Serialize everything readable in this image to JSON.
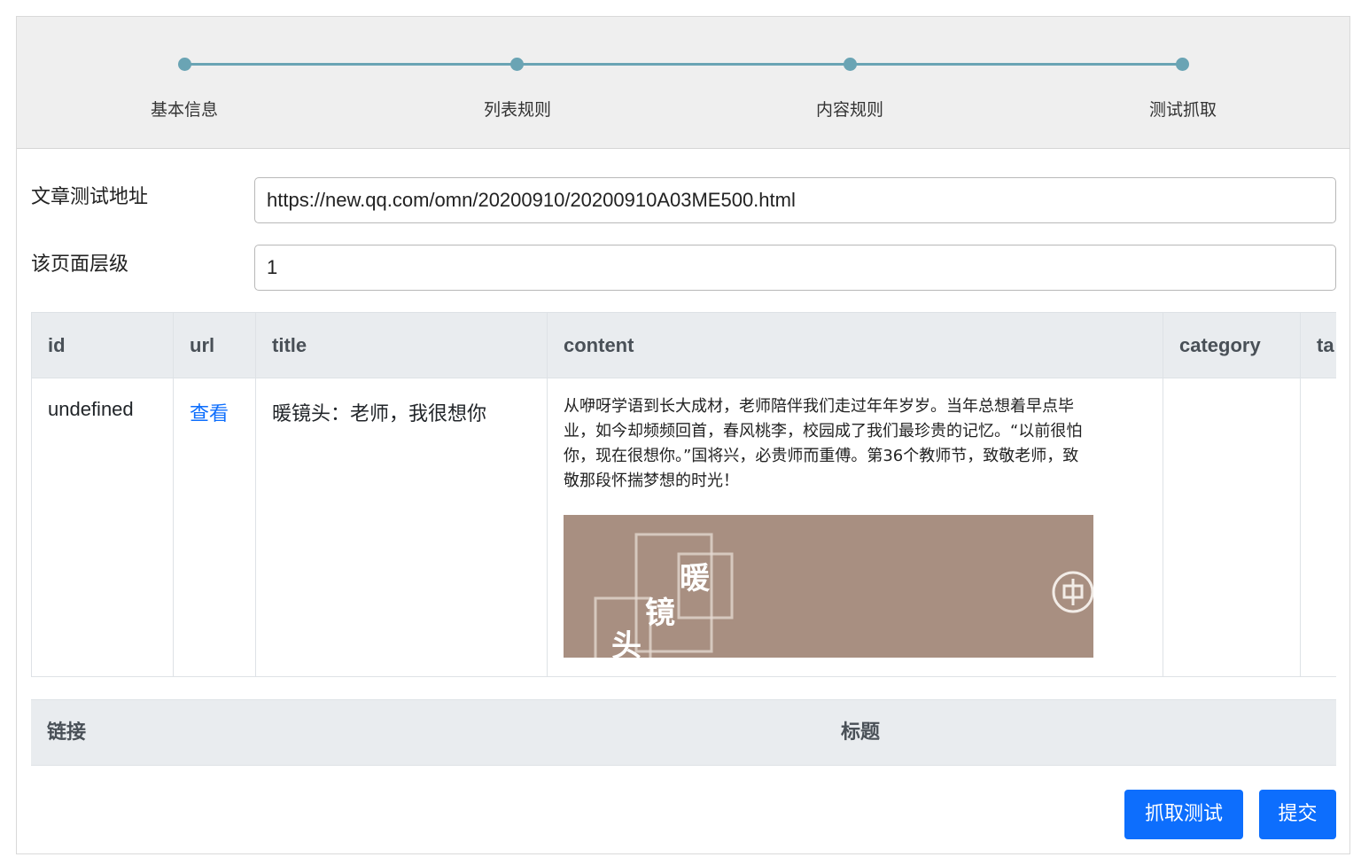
{
  "steps": [
    {
      "label": "基本信息"
    },
    {
      "label": "列表规则"
    },
    {
      "label": "内容规则"
    },
    {
      "label": "测试抓取"
    }
  ],
  "colors": {
    "step_accent": "#6aa4b4",
    "primary": "#0d6efd",
    "table_header_bg": "#e9ecef"
  },
  "form": {
    "test_url_label": "文章测试地址",
    "test_url_value": "https://new.qq.com/omn/20200910/20200910A03ME500.html",
    "page_level_label": "该页面层级",
    "page_level_value": "1"
  },
  "result_table": {
    "columns": [
      "id",
      "url",
      "title",
      "content",
      "category",
      "ta"
    ],
    "rows": [
      {
        "id": "undefined",
        "url": "查看",
        "title": "暖镜头：老师，我很想你",
        "content": "从咿呀学语到长大成材，老师陪伴我们走过年年岁岁。当年总想着早点毕业，如今却频频回首，春风桃李，校园成了我们最珍贵的记忆。“以前很怕你，现在很想你。”国将兴，必贵师而重傅。第36个教师节，致敬老师，致敬那段怀揣梦想的时光！",
        "image_text": [
          "暖",
          "镜",
          "头"
        ],
        "category": "",
        "ta": ""
      }
    ]
  },
  "link_table": {
    "columns": [
      "链接",
      "标题"
    ]
  },
  "buttons": {
    "test_fetch": "抓取测试",
    "submit": "提交"
  }
}
